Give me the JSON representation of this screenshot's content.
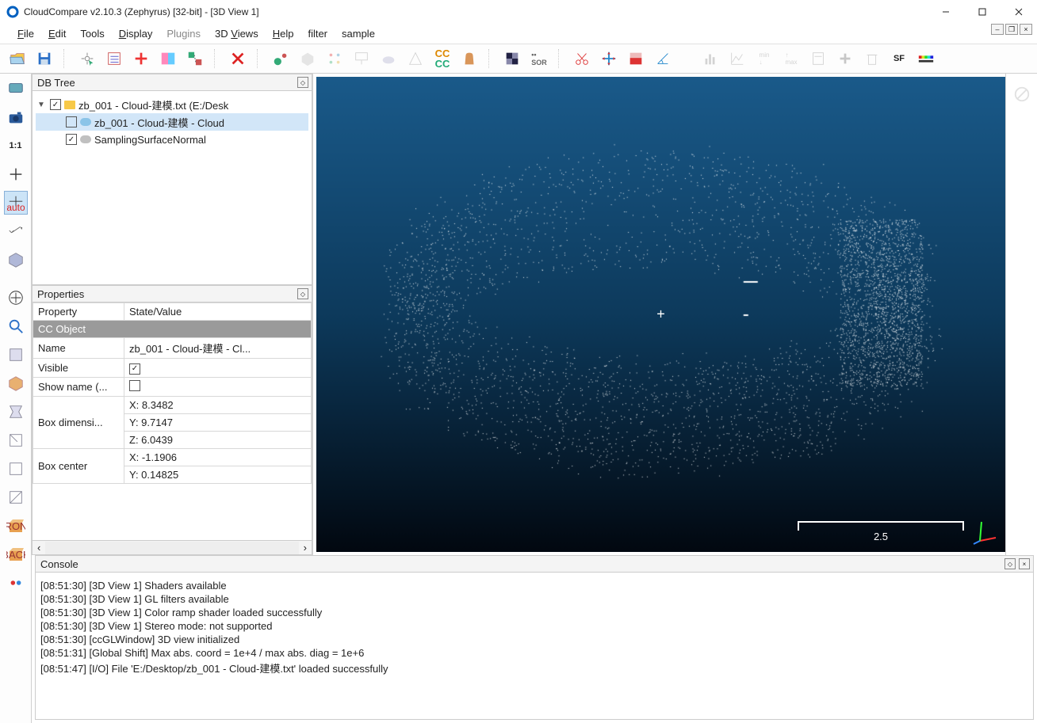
{
  "window": {
    "title": "CloudCompare v2.10.3 (Zephyrus) [32-bit] - [3D View 1]"
  },
  "menu": {
    "file": "File",
    "edit": "Edit",
    "tools": "Tools",
    "display": "Display",
    "plugins": "Plugins",
    "views": "3D Views",
    "help": "Help",
    "filter": "filter",
    "sample": "sample"
  },
  "panels": {
    "dbtree": "DB Tree",
    "properties": "Properties",
    "console": "Console"
  },
  "tree": {
    "root": {
      "label": "zb_001 - Cloud-建模.txt (E:/Desk",
      "checked": true
    },
    "child1": {
      "label": "zb_001 - Cloud-建模 - Cloud",
      "checked": false
    },
    "child2": {
      "label": "SamplingSurfaceNormal",
      "checked": true
    }
  },
  "properties": {
    "col_property": "Property",
    "col_value": "State/Value",
    "group": "CC Object",
    "name_k": "Name",
    "name_v": "zb_001 - Cloud-建模 - Cl...",
    "visible_k": "Visible",
    "showname_k": "Show name (...",
    "boxdim_k": "Box dimensi...",
    "box_x": "X: 8.3482",
    "box_y": "Y: 9.7147",
    "box_z": "Z: 6.0439",
    "center_k": "Box center",
    "center_x": "X: -1.1906",
    "center_y": "Y: 0.14825"
  },
  "viewport": {
    "scale": "2.5"
  },
  "console": {
    "lines": [
      "[08:51:30] [3D View 1] Shaders available",
      "[08:51:30] [3D View 1] GL filters available",
      "[08:51:30] [3D View 1] Color ramp shader loaded successfully",
      "[08:51:30] [3D View 1] Stereo mode: not supported",
      "[08:51:30] [ccGLWindow] 3D view initialized",
      "[08:51:31] [Global Shift] Max abs. coord = 1e+4 / max abs. diag = 1e+6",
      "[08:51:47] [I/O] File 'E:/Desktop/zb_001 - Cloud-建模.txt' loaded successfully"
    ]
  },
  "left_labels": {
    "oneone": "1:1",
    "auto": "auto",
    "front": "FRONT",
    "back": "BACK"
  }
}
